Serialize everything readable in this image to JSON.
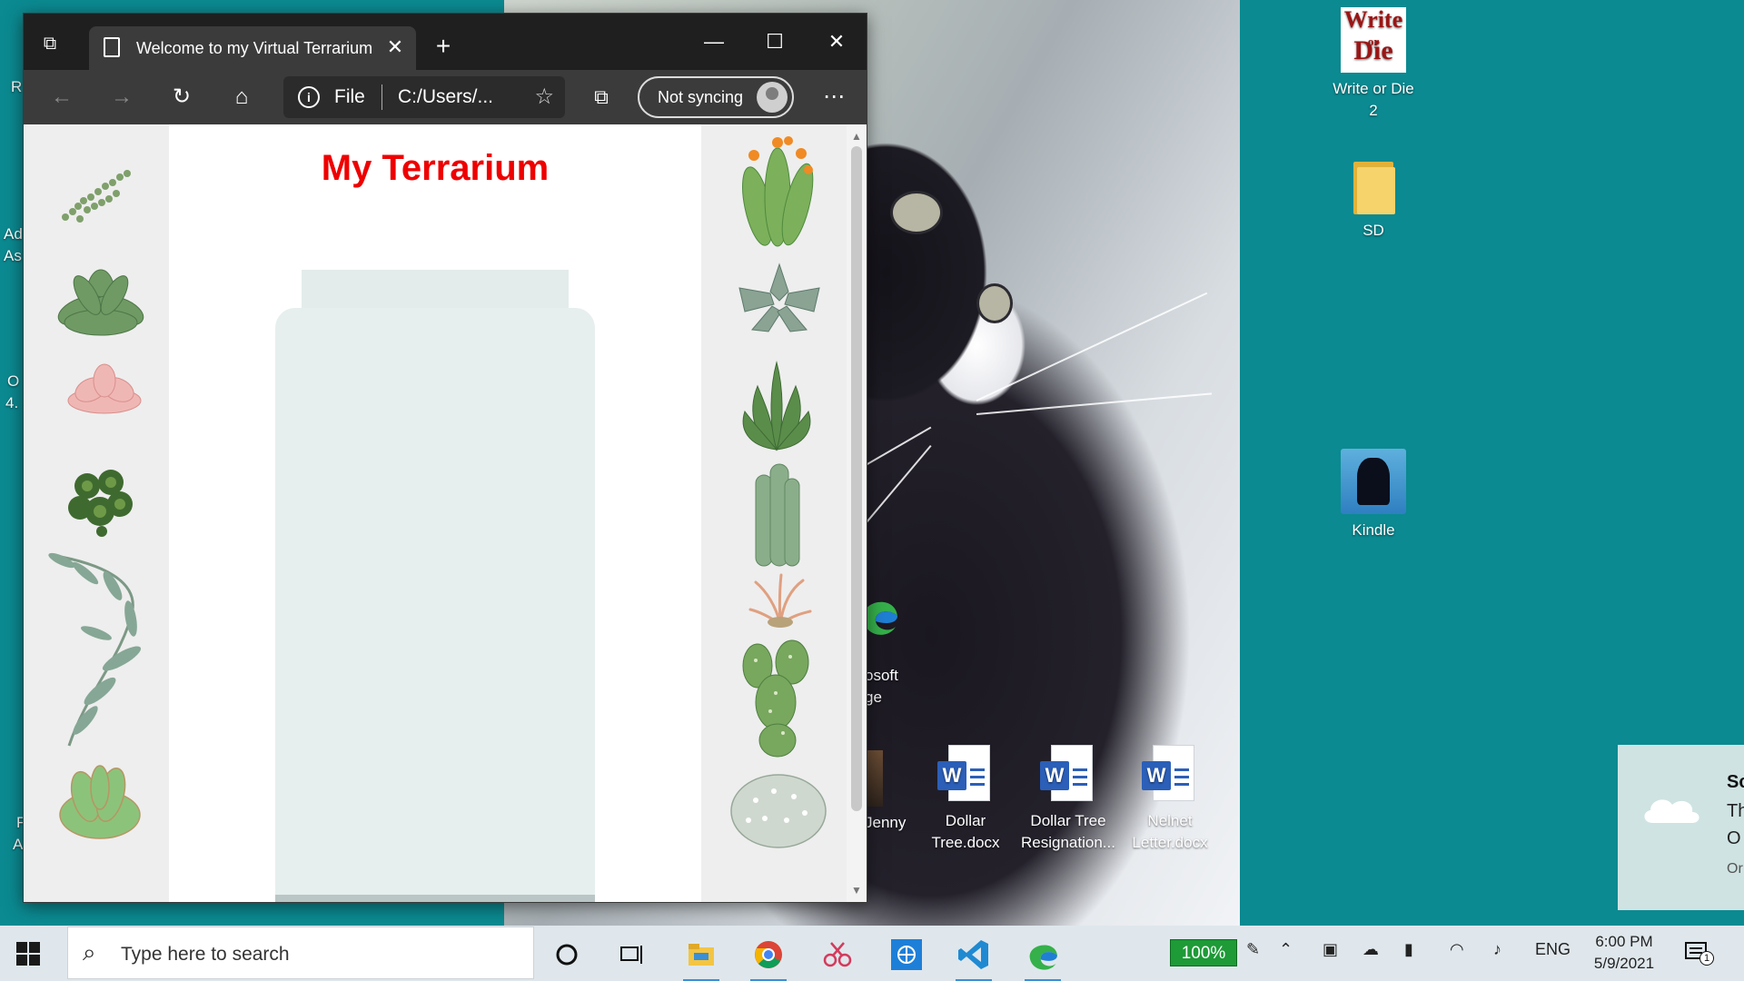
{
  "browser": {
    "tab_title": "Welcome to my Virtual Terrarium",
    "address_scheme": "File",
    "address_url": "C:/Users/...",
    "sync_label": "Not syncing"
  },
  "page": {
    "title": "My Terrarium"
  },
  "desktop_icons": [
    {
      "label": "Write or Die 2"
    },
    {
      "label": "SD"
    },
    {
      "label": "Kindle"
    },
    {
      "label": "Dollar Tree.docx"
    },
    {
      "label": "Dollar Tree Resignation..."
    },
    {
      "label": "Nelnet Letter.docx"
    }
  ],
  "desktop_clipped_labels": {
    "edge_line1": "osoft",
    "edge_line2": "ge",
    "jenny": "Jenny",
    "left_r": "R",
    "left_ad": "Ad",
    "left_as": "As",
    "left_o": "O",
    "left_4": "4.",
    "left_f": "F",
    "left_a": "A"
  },
  "taskbar": {
    "search_placeholder": "Type here to search",
    "battery_percent": "100%",
    "language": "ENG",
    "time": "6:00 PM",
    "date": "5/9/2021",
    "notification_count": "1"
  },
  "toast": {
    "line1": "Sc",
    "line2": "Th",
    "line3": "O",
    "line4": "Or"
  },
  "colors": {
    "desktop": "#0b8a91",
    "title": "#ee0000",
    "jar": "#e6efee"
  }
}
